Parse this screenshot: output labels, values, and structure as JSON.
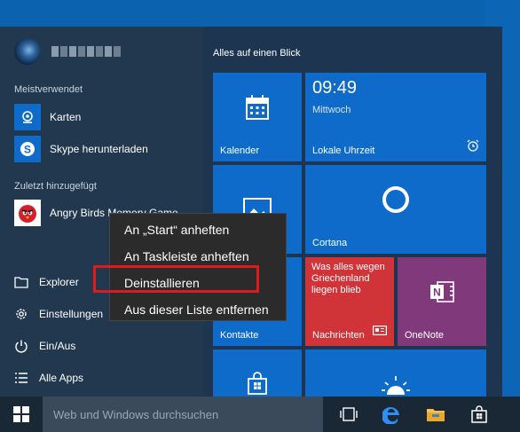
{
  "start_menu": {
    "most_used_label": "Meistverwendet",
    "recent_label": "Zuletzt hinzugefügt",
    "apps": [
      {
        "label": "Karten",
        "icon": "maps-icon"
      },
      {
        "label": "Skype herunterladen",
        "icon": "skype-icon"
      }
    ],
    "recent_app": {
      "label": "Angry Birds Memory Game",
      "icon": "angry-birds-icon"
    },
    "nav": {
      "explorer": "Explorer",
      "settings": "Einstellungen",
      "power": "Ein/Aus",
      "all_apps": "Alle Apps"
    }
  },
  "tiles": {
    "header": "Alles auf einen Blick",
    "calendar": "Kalender",
    "clock_time": "09:49",
    "clock_day": "Mittwoch",
    "clock_label": "Lokale Uhrzeit",
    "cortana": "Cortana",
    "contacts": "Kontakte",
    "news_headline": "Was alles wegen Griechenland liegen blieb",
    "news_label": "Nachrichten",
    "onenote": "OneNote"
  },
  "context_menu": {
    "items": [
      "An „Start“ anheften",
      "An Taskleiste anheften",
      "Deinstallieren",
      "Aus dieser Liste entfernen"
    ]
  },
  "taskbar": {
    "search_placeholder": "Web und Windows durchsuchen"
  },
  "colors": {
    "tile_blue": "#0e6bc9",
    "news_red": "#d13438",
    "onenote_purple": "#80397b",
    "highlight_red": "#e01a1a"
  }
}
